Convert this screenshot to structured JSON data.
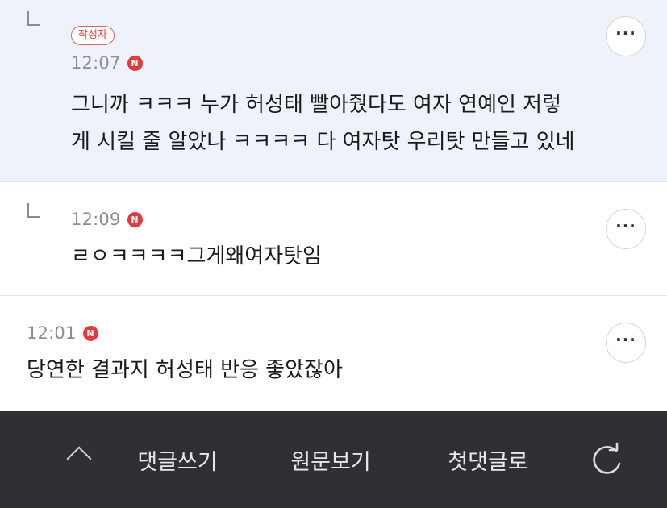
{
  "comments": [
    {
      "is_reply": true,
      "author_badge": "작성자",
      "time": "12:07",
      "new_badge": "N",
      "text_line1": "그니까 ㅋㅋㅋ 누가 허성태 빨아줬다도 여자 연예인 저렇",
      "text_line2": "게 시킬 줄 알았나 ㅋㅋㅋㅋ 다 여자탓 우리탓 만들고 있네",
      "more_icon": "more-horizontal-icon"
    },
    {
      "is_reply": true,
      "time": "12:09",
      "new_badge": "N",
      "text": "ㄹㅇㅋㅋㅋㅋ그게왜여자탓임",
      "more_icon": "more-horizontal-icon"
    },
    {
      "is_reply": false,
      "time": "12:01",
      "new_badge": "N",
      "text": "당연한 결과지 허성태 반응 좋았잖아",
      "more_icon": "more-horizontal-icon"
    }
  ],
  "bottom_bar": {
    "scroll_top_icon": "chevron-up-icon",
    "write_comment": "댓글쓰기",
    "view_original": "원문보기",
    "first_comment": "첫댓글로",
    "refresh_icon": "refresh-icon"
  },
  "colors": {
    "author_row_bg": "#eef2fa",
    "badge_red": "#e7393a",
    "bar_bg": "#2f3034"
  }
}
